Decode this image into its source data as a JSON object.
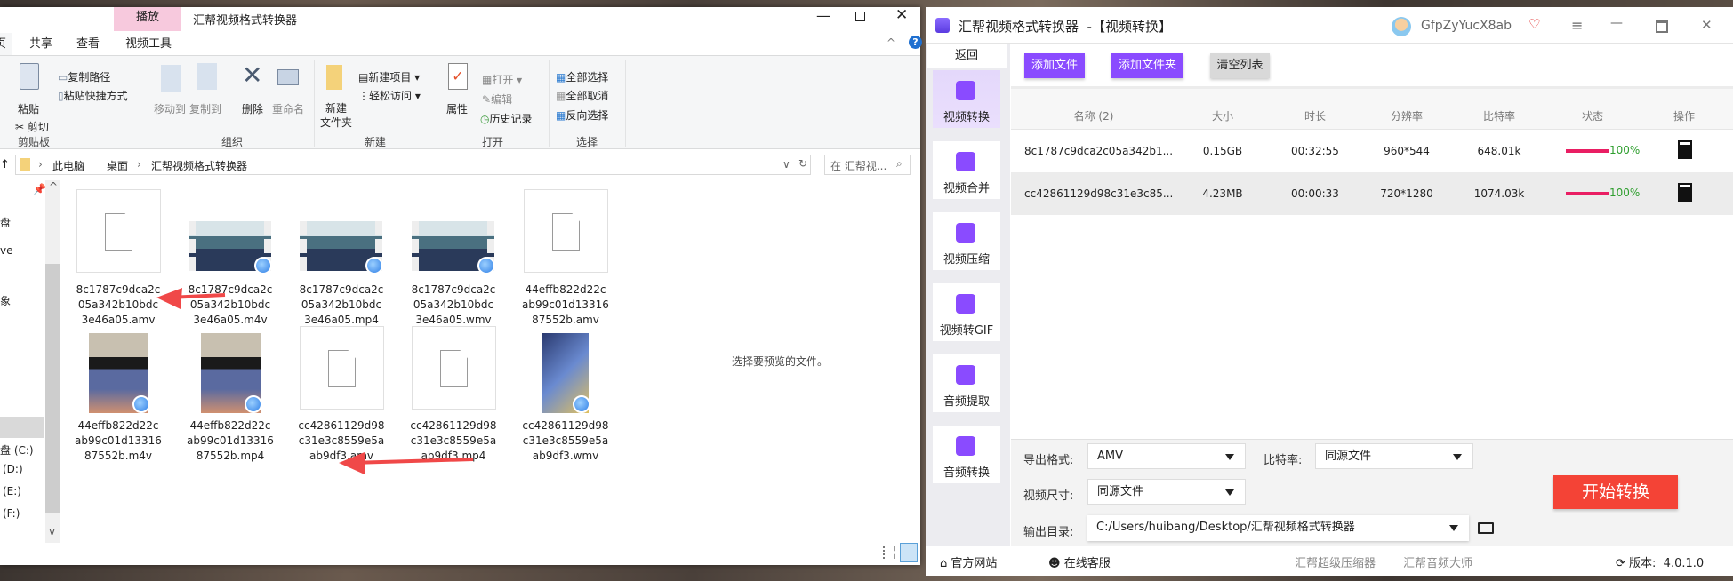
{
  "explorer": {
    "title": "汇帮视频格式转换器",
    "context_tab": "播放",
    "tabs": [
      "页",
      "共享",
      "查看",
      "视频工具"
    ],
    "ribbon": {
      "clipboard": {
        "label": "剪贴板",
        "paste": "粘贴",
        "cut": "剪切",
        "copy_path": "复制路径",
        "paste_shortcut": "粘贴快捷方式"
      },
      "organize": {
        "label": "组织",
        "move_to": "移动到",
        "copy_to": "复制到",
        "delete": "删除",
        "rename": "重命名"
      },
      "new": {
        "label": "新建",
        "new_folder_1": "新建",
        "new_folder_2": "文件夹",
        "new_item": "新建项目",
        "easy_access": "轻松访问"
      },
      "open": {
        "label": "打开",
        "properties": "属性",
        "open": "打开",
        "edit": "编辑",
        "history": "历史记录"
      },
      "select": {
        "label": "选择",
        "select_all": "全部选择",
        "select_none": "全部取消",
        "invert": "反向选择"
      }
    },
    "breadcrumb": [
      "此电脑",
      "桌面",
      "汇帮视频格式转换器"
    ],
    "search_placeholder": "在 汇帮视...",
    "nav": [
      "盘",
      "ve",
      "象",
      "盘 (C:)",
      "(D:)",
      "(E:)",
      "(F:)"
    ],
    "files": [
      {
        "l1": "8c1787c9dca2c",
        "l2": "05a342b10bdc",
        "l3": "3e46a05.amv",
        "kind": "blank"
      },
      {
        "l1": "8c1787c9dca2c",
        "l2": "05a342b10bdc",
        "l3": "3e46a05.m4v",
        "kind": "film"
      },
      {
        "l1": "8c1787c9dca2c",
        "l2": "05a342b10bdc",
        "l3": "3e46a05.mp4",
        "kind": "film"
      },
      {
        "l1": "8c1787c9dca2c",
        "l2": "05a342b10bdc",
        "l3": "3e46a05.wmv",
        "kind": "film"
      },
      {
        "l1": "44effb822d22c",
        "l2": "ab99c01d13316",
        "l3": "87552b.amv",
        "kind": "blank"
      },
      {
        "l1": "44effb822d22c",
        "l2": "ab99c01d13316",
        "l3": "87552b.m4v",
        "kind": "portrait"
      },
      {
        "l1": "44effb822d22c",
        "l2": "ab99c01d13316",
        "l3": "87552b.mp4",
        "kind": "portrait"
      },
      {
        "l1": "cc42861129d98",
        "l2": "c31e3c8559e5a",
        "l3": "ab9df3.amv",
        "kind": "blank"
      },
      {
        "l1": "cc42861129d98",
        "l2": "c31e3c8559e5a",
        "l3": "ab9df3.mp4",
        "kind": "blank"
      },
      {
        "l1": "cc42861129d98",
        "l2": "c31e3c8559e5a",
        "l3": "ab9df3.wmv",
        "kind": "poster"
      }
    ],
    "preview_text": "选择要预览的文件。"
  },
  "app": {
    "title": "汇帮视频格式转换器  -【视频转换】",
    "username": "GfpZyYucX8ab",
    "back": "返回",
    "sidebar": [
      "视频转换",
      "视频合并",
      "视频压缩",
      "视频转GIF",
      "音频提取",
      "音频转换"
    ],
    "toolbar": {
      "add_file": "添加文件",
      "add_folder": "添加文件夹",
      "clear": "清空列表"
    },
    "columns": [
      "名称 (2)",
      "大小",
      "时长",
      "分辨率",
      "比特率",
      "状态",
      "操作"
    ],
    "rows": [
      {
        "name": "8c1787c9dca2c05a342b1...",
        "size": "0.15GB",
        "duration": "00:32:55",
        "resolution": "960*544",
        "bitrate": "648.01k",
        "progress": "100%"
      },
      {
        "name": "cc42861129d98c31e3c85...",
        "size": "4.23MB",
        "duration": "00:00:33",
        "resolution": "720*1280",
        "bitrate": "1074.03k",
        "progress": "100%"
      }
    ],
    "settings": {
      "format_label": "导出格式:",
      "format": "AMV",
      "bitrate_label": "比特率:",
      "bitrate": "同源文件",
      "size_label": "视频尺寸:",
      "size": "同源文件",
      "output_label": "输出目录:",
      "output": "C:/Users/huibang/Desktop/汇帮视频格式转换器"
    },
    "start": "开始转换",
    "footer": {
      "website": "官方网站",
      "support": "在线客服",
      "link1": "汇帮超级压缩器",
      "link2": "汇帮音频大师",
      "version": "版本:  4.0.1.0"
    },
    "colors": {
      "accent": "#8a4bff",
      "start": "#f44336",
      "progress": "#e91e63",
      "ok": "#2e9e2e"
    }
  }
}
